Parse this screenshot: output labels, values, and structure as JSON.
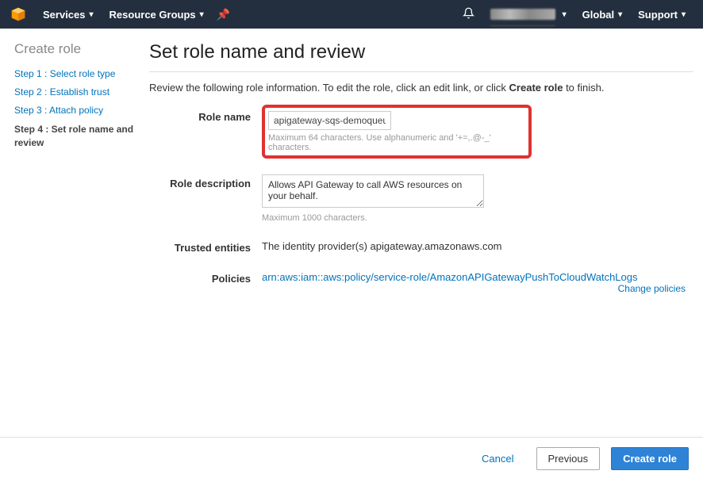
{
  "nav": {
    "services": "Services",
    "resource_groups": "Resource Groups",
    "global": "Global",
    "support": "Support"
  },
  "sidebar": {
    "title": "Create role",
    "steps": [
      "Step 1 : Select role type",
      "Step 2 : Establish trust",
      "Step 3 : Attach policy",
      "Step 4 : Set role name and review"
    ]
  },
  "page": {
    "title": "Set role name and review",
    "review_prefix": "Review the following role information. To edit the role, click an edit link, or click ",
    "review_bold": "Create role",
    "review_suffix": " to finish."
  },
  "form": {
    "role_name_label": "Role name",
    "role_name_value": "apigateway-sqs-demoqueue",
    "role_name_hint": "Maximum 64 characters. Use alphanumeric and '+=,.@-_' characters.",
    "role_desc_label": "Role description",
    "role_desc_value": "Allows API Gateway to call AWS resources on your behalf.",
    "role_desc_hint": "Maximum 1000 characters.",
    "trusted_label": "Trusted entities",
    "trusted_value": "The identity provider(s) apigateway.amazonaws.com",
    "policies_label": "Policies",
    "policies_value": "arn:aws:iam::aws:policy/service-role/AmazonAPIGatewayPushToCloudWatchLogs",
    "change_policies": "Change policies"
  },
  "footer": {
    "cancel": "Cancel",
    "previous": "Previous",
    "create": "Create role"
  }
}
